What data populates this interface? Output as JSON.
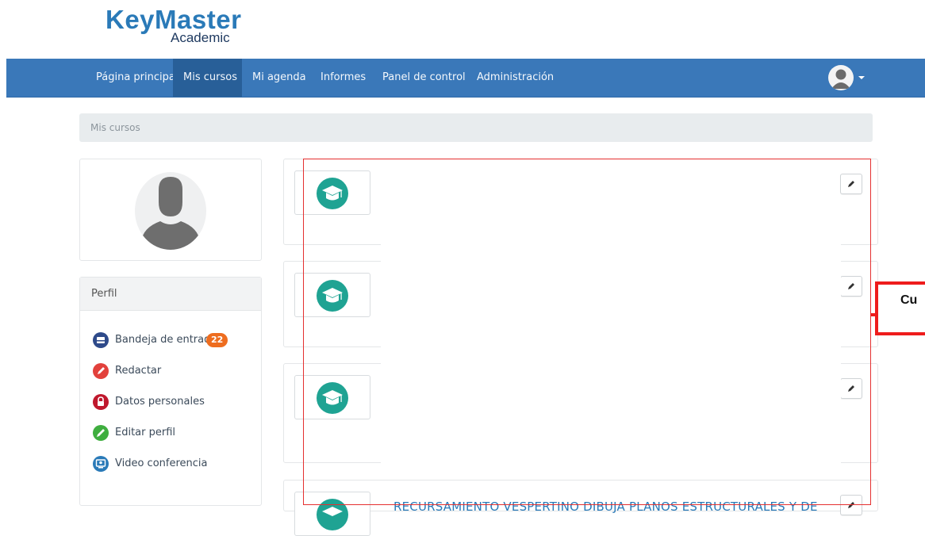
{
  "brand": {
    "name_part1": "Key",
    "name_part2": "Master",
    "subtitle": "Academic",
    "color": "#2a7ab8"
  },
  "navbar": {
    "items": [
      {
        "label": "Página principal",
        "active": false
      },
      {
        "label": "Mis cursos",
        "active": true
      },
      {
        "label": "Mi agenda",
        "active": false
      },
      {
        "label": "Informes",
        "active": false
      },
      {
        "label": "Panel de control",
        "active": false
      },
      {
        "label": "Administración",
        "active": false
      }
    ],
    "user_menu_icon": "user-avatar-icon",
    "color": "#3a78b9"
  },
  "breadcrumb": {
    "current": "Mis cursos"
  },
  "profile_panel": {
    "title": "Perfil",
    "links": [
      {
        "label": "Bandeja de entrada",
        "badge": "22",
        "icon": "inbox-icon",
        "color": "#2e4a8a"
      },
      {
        "label": "Redactar",
        "icon": "compose-icon",
        "color": "#e2413c"
      },
      {
        "label": "Datos personales",
        "icon": "lock-icon",
        "color": "#c0182d"
      },
      {
        "label": "Editar perfil",
        "icon": "pencil-icon",
        "color": "#3fae3f"
      },
      {
        "label": "Video conferencia",
        "icon": "video-conference-icon",
        "color": "#2a7ab8"
      }
    ]
  },
  "courses": [
    {
      "title": "",
      "icon": "graduation-cap-icon"
    },
    {
      "title": "",
      "icon": "graduation-cap-icon"
    },
    {
      "title": "",
      "icon": "graduation-cap-icon"
    },
    {
      "title": "RECURSAMIENTO VESPERTINO DIBUJA PLANOS ESTRUCTURALES Y DE",
      "icon": "graduation-cap-icon"
    }
  ],
  "annotation": {
    "callout_text": "Cu",
    "color": "#ee1c1c"
  }
}
